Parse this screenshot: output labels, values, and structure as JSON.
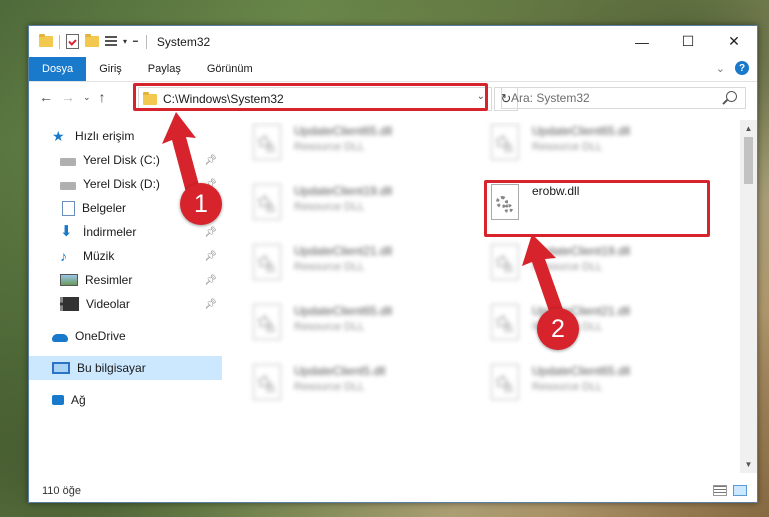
{
  "window": {
    "title": "System32",
    "controls": {
      "minimize": "—",
      "maximize": "☐",
      "close": "✕"
    }
  },
  "ribbon": {
    "tabs": [
      {
        "label": "Dosya",
        "active": true
      },
      {
        "label": "Giriş",
        "active": false
      },
      {
        "label": "Paylaş",
        "active": false
      },
      {
        "label": "Görünüm",
        "active": false
      }
    ],
    "help": "?"
  },
  "address": {
    "path": "C:\\Windows\\System32",
    "search_placeholder": "Ara: System32"
  },
  "sidebar": {
    "items": [
      {
        "label": "Hızlı erişim",
        "icon": "star-icon",
        "pinned": false
      },
      {
        "label": "Yerel Disk (C:)",
        "icon": "disk-icon",
        "pinned": true
      },
      {
        "label": "Yerel Disk (D:)",
        "icon": "disk-icon",
        "pinned": true
      },
      {
        "label": "Belgeler",
        "icon": "document-icon",
        "pinned": true
      },
      {
        "label": "İndirmeler",
        "icon": "download-icon",
        "pinned": true
      },
      {
        "label": "Müzik",
        "icon": "music-icon",
        "pinned": true
      },
      {
        "label": "Resimler",
        "icon": "pictures-icon",
        "pinned": true
      },
      {
        "label": "Videolar",
        "icon": "video-icon",
        "pinned": true
      },
      {
        "label": "OneDrive",
        "icon": "cloud-icon",
        "pinned": false
      },
      {
        "label": "Bu bilgisayar",
        "icon": "computer-icon",
        "pinned": false,
        "selected": true
      },
      {
        "label": "Ağ",
        "icon": "network-icon",
        "pinned": false
      }
    ]
  },
  "files": [
    {
      "name": "UpdateClient65.dll",
      "type": "Resource DLL",
      "blurred": true
    },
    {
      "name": "UpdateClient65.dll",
      "type": "Resource DLL",
      "blurred": true
    },
    {
      "name": "UpdateClient19.dll",
      "type": "Resource DLL",
      "blurred": true
    },
    {
      "name": "erobw.dll",
      "type": "",
      "blurred": false,
      "highlighted": true
    },
    {
      "name": "UpdateClient21.dll",
      "type": "Resource DLL",
      "blurred": true
    },
    {
      "name": "UpdateClient19.dll",
      "type": "Resource DLL",
      "blurred": true
    },
    {
      "name": "UpdateClient65.dll",
      "type": "Resource DLL",
      "blurred": true
    },
    {
      "name": "UpdateClient21.dll",
      "type": "Resource DLL",
      "blurred": true
    },
    {
      "name": "UpdateClient5.dll",
      "type": "Resource DLL",
      "blurred": true
    },
    {
      "name": "UpdateClient65.dll",
      "type": "Resource DLL",
      "blurred": true
    }
  ],
  "status": {
    "item_count": "110 öğe"
  },
  "annotations": {
    "step1": "1",
    "step2": "2",
    "color": "#d6232c"
  }
}
